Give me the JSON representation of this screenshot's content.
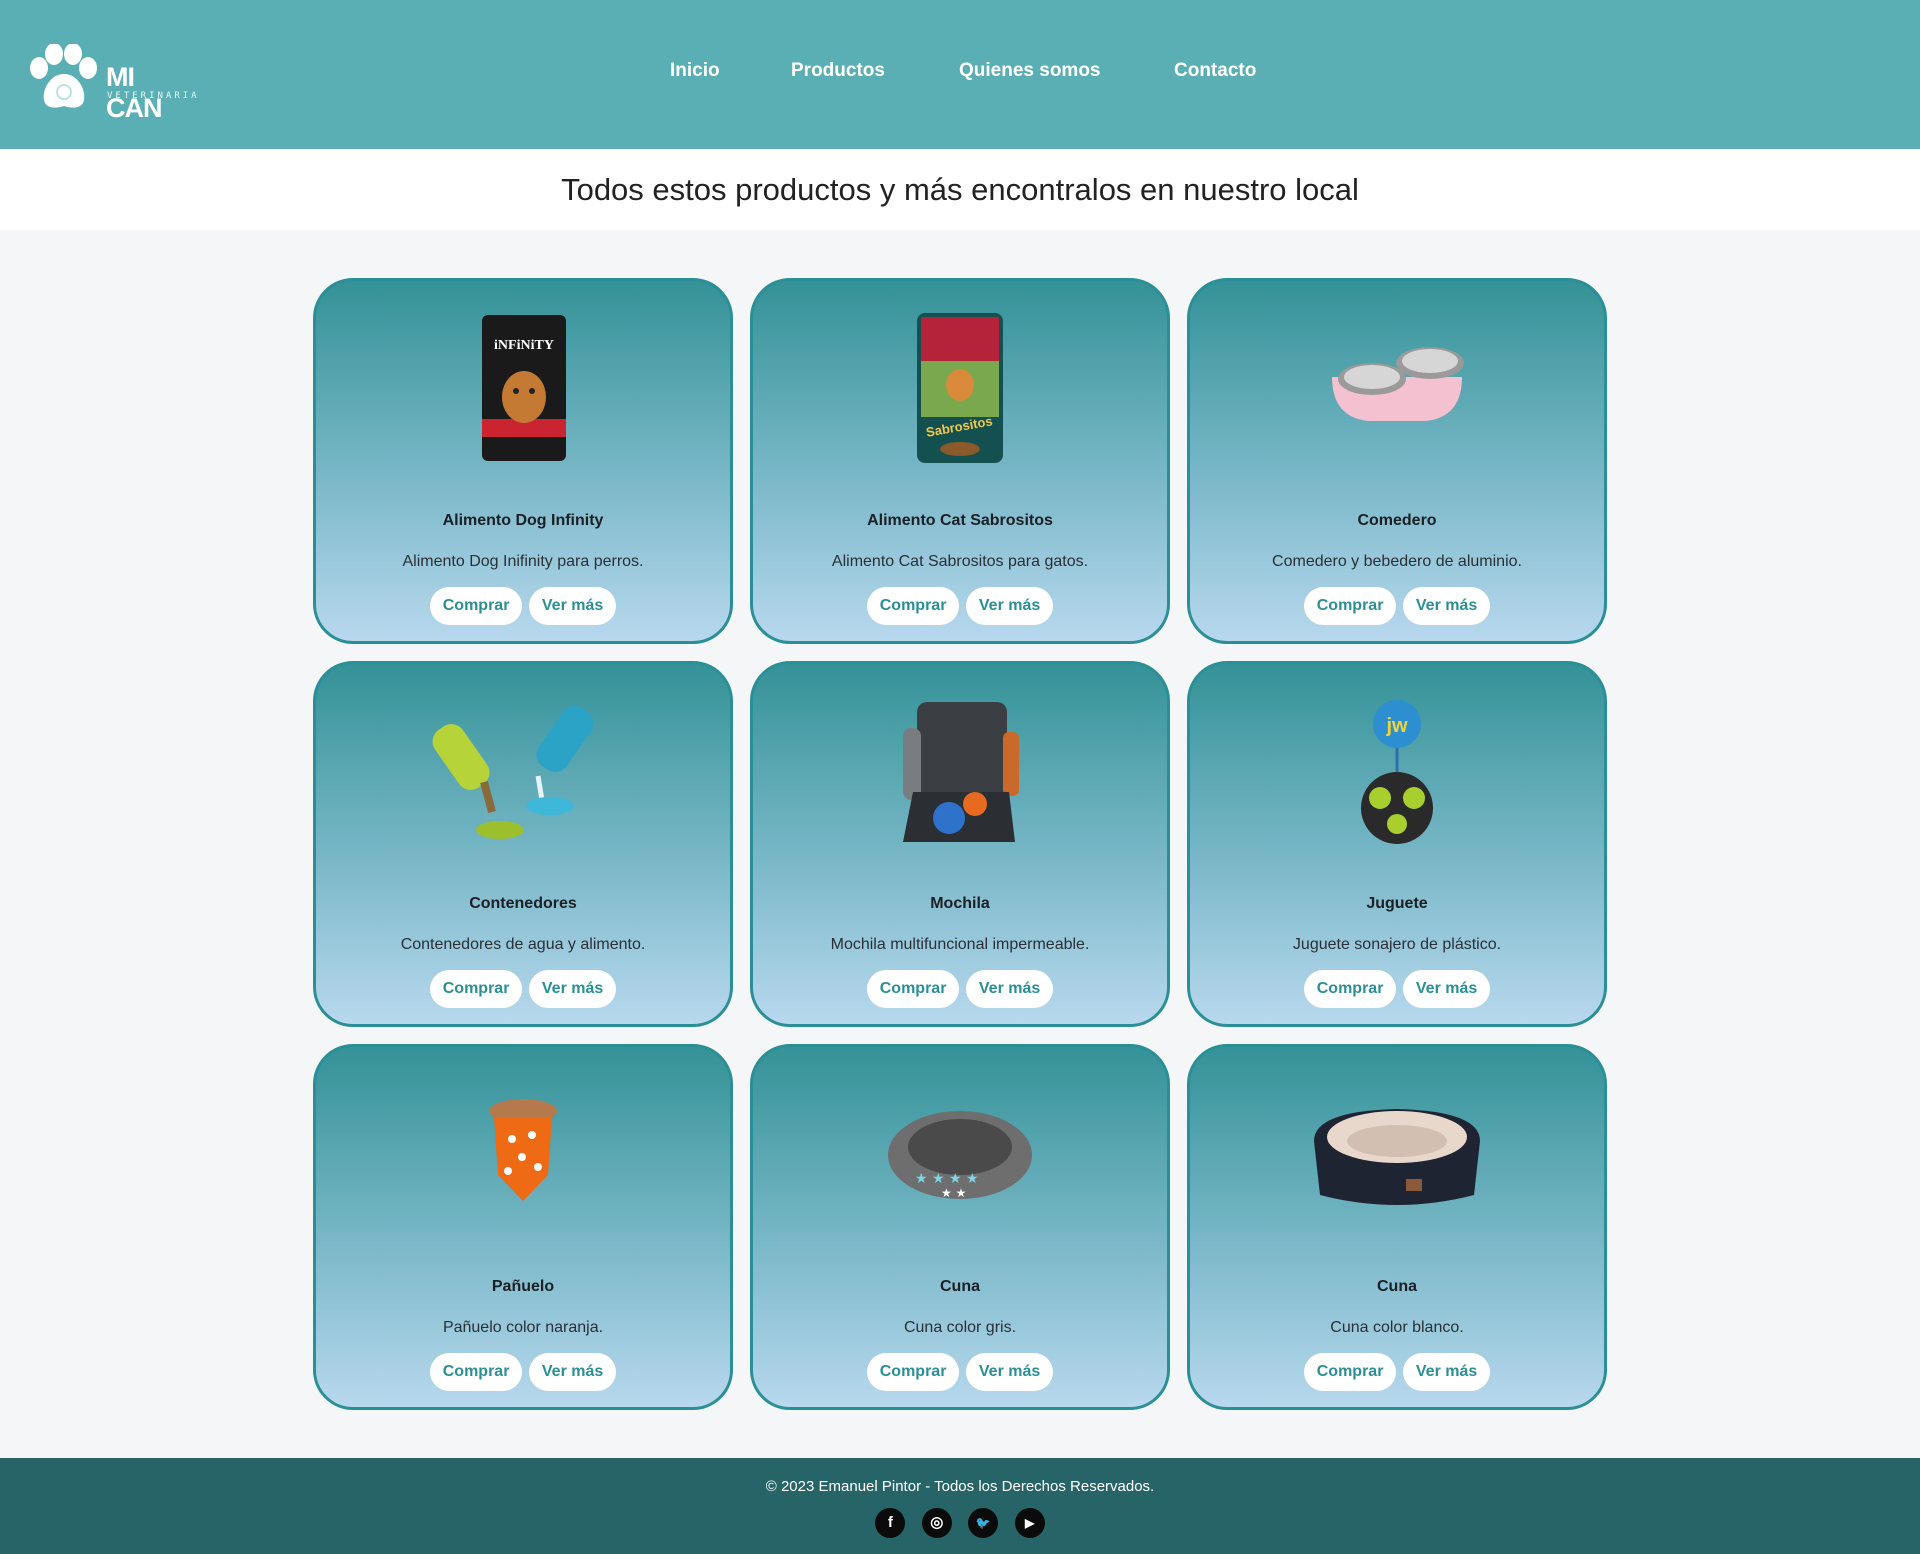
{
  "brand": {
    "name": "MI CAN",
    "subtitle": "VETERINARIA"
  },
  "nav": {
    "items": [
      {
        "label": "Inicio"
      },
      {
        "label": "Productos"
      },
      {
        "label": "Quienes somos"
      },
      {
        "label": "Contacto"
      }
    ]
  },
  "banner": {
    "heading": "Todos estos productos y más encontralos en nuestro local"
  },
  "products": [
    {
      "title": "Alimento Dog Infinity",
      "description": "Alimento Dog Inifinity para perros.",
      "icon": "dog-food-bag-icon",
      "buy_label": "Comprar",
      "more_label": "Ver más"
    },
    {
      "title": "Alimento Cat Sabrositos",
      "description": "Alimento Cat Sabrositos para gatos.",
      "icon": "cat-food-bag-icon",
      "buy_label": "Comprar",
      "more_label": "Ver más"
    },
    {
      "title": "Comedero",
      "description": "Comedero y bebedero de aluminio.",
      "icon": "pet-bowl-icon",
      "buy_label": "Comprar",
      "more_label": "Ver más"
    },
    {
      "title": "Contenedores",
      "description": "Contenedores de agua y alimento.",
      "icon": "containers-icon",
      "buy_label": "Comprar",
      "more_label": "Ver más"
    },
    {
      "title": "Mochila",
      "description": "Mochila multifuncional impermeable.",
      "icon": "backpack-icon",
      "buy_label": "Comprar",
      "more_label": "Ver más"
    },
    {
      "title": "Juguete",
      "description": "Juguete sonajero de plástico.",
      "icon": "toy-ball-icon",
      "buy_label": "Comprar",
      "more_label": "Ver más"
    },
    {
      "title": "Pañuelo",
      "description": "Pañuelo color naranja.",
      "icon": "bandana-icon",
      "buy_label": "Comprar",
      "more_label": "Ver más"
    },
    {
      "title": "Cuna",
      "description": "Cuna color gris.",
      "icon": "gray-bed-icon",
      "buy_label": "Comprar",
      "more_label": "Ver más"
    },
    {
      "title": "Cuna",
      "description": "Cuna color blanco.",
      "icon": "dark-bed-icon",
      "buy_label": "Comprar",
      "more_label": "Ver más"
    }
  ],
  "footer": {
    "copyright": "© 2023 Emanuel Pintor - Todos los Derechos Reservados.",
    "socials": [
      {
        "name": "facebook-icon",
        "glyph": "f"
      },
      {
        "name": "instagram-icon",
        "glyph": "◎"
      },
      {
        "name": "twitter-icon",
        "glyph": "🐦"
      },
      {
        "name": "youtube-icon",
        "glyph": "▶"
      }
    ]
  },
  "colors": {
    "header": "#5aafb4",
    "card_border": "#2a8f96",
    "footer": "#266468",
    "button_text": "#2a8f96"
  }
}
